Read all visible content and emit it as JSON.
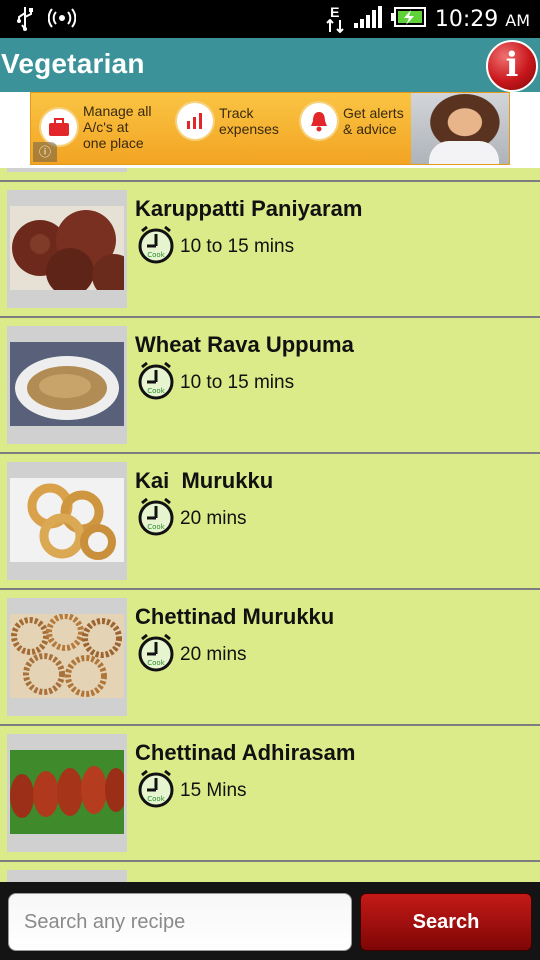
{
  "status_bar": {
    "network_type": "E",
    "time": "10:29",
    "ampm": "AM",
    "icons": [
      "usb-icon",
      "wireless-hotspot-icon",
      "data-transfer-icon",
      "signal-icon",
      "battery-icon"
    ]
  },
  "header": {
    "title": "Vegetarian",
    "info_icon": "i"
  },
  "ad": {
    "items": [
      {
        "text": "Manage all\nA/c's at\none place",
        "icon": "briefcase-icon"
      },
      {
        "text": "Track\nexpenses",
        "icon": "chart-icon"
      },
      {
        "text": "Get alerts\n& advice",
        "icon": "bell-icon"
      }
    ],
    "info_glyph": "ⓘ"
  },
  "recipes": [
    {
      "name": "Karuppatti Paniyaram",
      "time": "10 to 15 mins",
      "image": "paniyaram-photo"
    },
    {
      "name": "Wheat Rava Uppuma",
      "time": "10 to 15 mins",
      "image": "uppuma-photo"
    },
    {
      "name": "Kai  Murukku",
      "time": "20 mins",
      "image": "kai-murukku-photo"
    },
    {
      "name": "Chettinad Murukku",
      "time": "20 mins",
      "image": "chettinad-murukku-photo"
    },
    {
      "name": "Chettinad Adhirasam",
      "time": "15 Mins",
      "image": "adhirasam-photo"
    }
  ],
  "clock_label": "Cook",
  "search": {
    "placeholder": "Search any recipe",
    "value": "",
    "button_label": "Search"
  },
  "colors": {
    "title_bar": "#3b9399",
    "list_background": "#dbeb89",
    "search_button": "#a30f0e"
  }
}
